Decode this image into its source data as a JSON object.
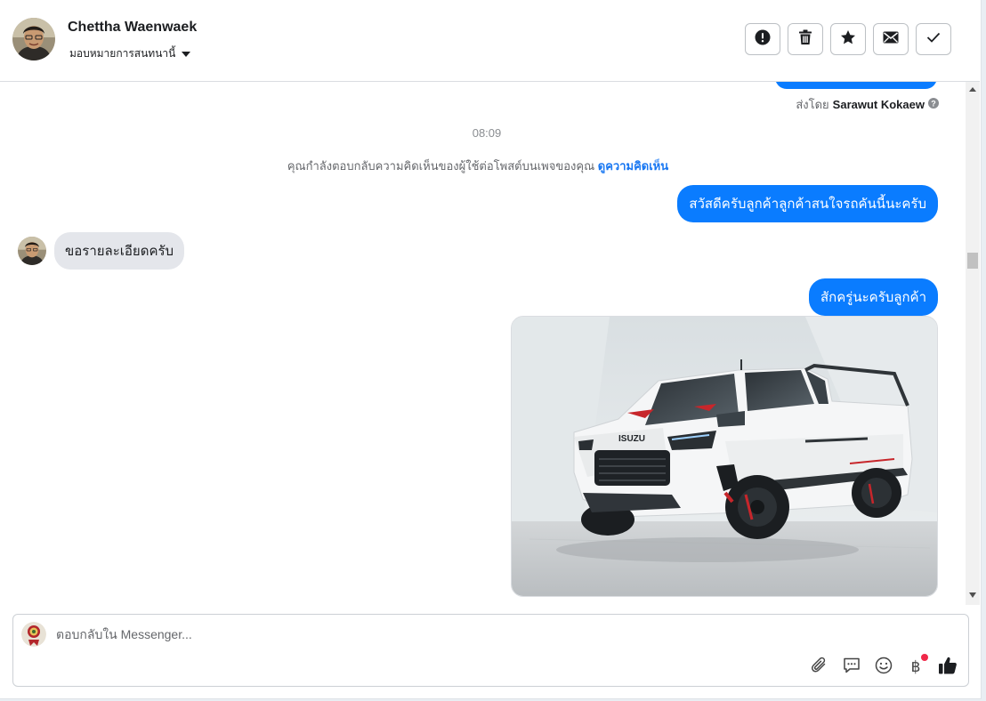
{
  "header": {
    "name": "Chettha Waenwaek",
    "assign_label": "มอบหมายการสนทนานี้"
  },
  "conversation": {
    "sent_by_prefix": "ส่งโดย",
    "sent_by_name": "Sarawut Kokaew",
    "timestamp": "08:09",
    "notice_text": "คุณกำลังตอบกลับความคิดเห็นของผู้ใช้ต่อโพสต์บนเพจของคุณ",
    "notice_link": "ดูความคิดเห็น",
    "messages": [
      {
        "direction": "outgoing",
        "text": "สวัสดีครับลูกค้าลูกค้าสนใจรถคันนี้นะครับ"
      },
      {
        "direction": "incoming",
        "text": "ขอรายละเอียดครับ"
      },
      {
        "direction": "outgoing",
        "text": "สักครู่นะครับลูกค้า"
      }
    ],
    "image_caption": "ISUZU"
  },
  "composer": {
    "placeholder": "ตอบกลับใน Messenger...",
    "currency_symbol": "฿"
  },
  "colors": {
    "outgoing_bubble": "#0a7cff",
    "incoming_bubble": "#e4e6eb",
    "link": "#1877f2",
    "notification_dot": "#f02849"
  },
  "icons": [
    "alert-icon",
    "trash-icon",
    "star-icon",
    "envelope-icon",
    "check-icon",
    "attachment-icon",
    "saved-replies-icon",
    "emoji-icon",
    "baht-icon",
    "thumbs-up-icon"
  ]
}
